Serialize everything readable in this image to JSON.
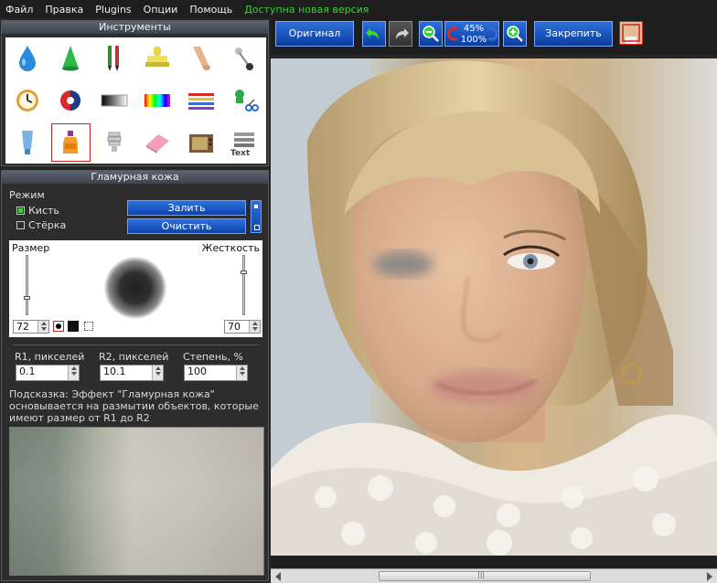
{
  "menu": {
    "file": "Файл",
    "edit": "Правка",
    "plugins": "Plugins",
    "options": "Опции",
    "help": "Помощь",
    "update": "Доступна новая версия"
  },
  "tools_panel": {
    "title": "Инструменты",
    "tools": [
      {
        "name": "drop-icon",
        "color": "#2a8bd8"
      },
      {
        "name": "cone-icon",
        "color": "#2fb84a"
      },
      {
        "name": "brush-icon",
        "color": "#3a8a3a"
      },
      {
        "name": "stamp-icon",
        "color": "#e6d34a"
      },
      {
        "name": "finger-icon",
        "color": "#e7b48f"
      },
      {
        "name": "pin-icon",
        "color": "#444444"
      },
      {
        "name": "clock-icon",
        "color": "#d9a33a"
      },
      {
        "name": "color-wheel-icon",
        "color": "#d42a2a"
      },
      {
        "name": "gradient-icon",
        "color": "#444444"
      },
      {
        "name": "spectrum-icon",
        "color": "#ff6a00"
      },
      {
        "name": "lines-icon",
        "color": "#8a3ad4"
      },
      {
        "name": "scissors-icon",
        "color": "#2fa84a"
      },
      {
        "name": "tube-icon",
        "color": "#7ab3e0"
      },
      {
        "name": "bottle-icon",
        "color": "#f29a2a"
      },
      {
        "name": "bulb-icon",
        "color": "#d0d0d0"
      },
      {
        "name": "eraser-icon",
        "color": "#f2a0b8"
      },
      {
        "name": "tv-icon",
        "color": "#7a5a3a"
      },
      {
        "name": "text-icon",
        "color": "#666666"
      }
    ],
    "text_tool_label": "Text"
  },
  "glamour": {
    "title": "Гламурная кожа",
    "mode_label": "Режим",
    "brush_label": "Кисть",
    "eraser_label": "Стёрка",
    "fill_button": "Залить",
    "clear_button": "Очистить",
    "size_label": "Размер",
    "hardness_label": "Жесткость",
    "size_value": "72",
    "hardness_value": "70",
    "r1_label": "R1, пикселей",
    "r2_label": "R2, пикселей",
    "degree_label": "Степень, %",
    "r1_value": "0.1",
    "r2_value": "10.1",
    "degree_value": "100",
    "hint": "Подсказка: Эффект \"Гламурная кожа\" основывается на размытии объектов, которые имеют размер от R1 до R2"
  },
  "toolbar": {
    "original_button": "Оригинал",
    "zoom_top": "45%",
    "zoom_bottom": "100%",
    "pin_button": "Закрепить"
  }
}
